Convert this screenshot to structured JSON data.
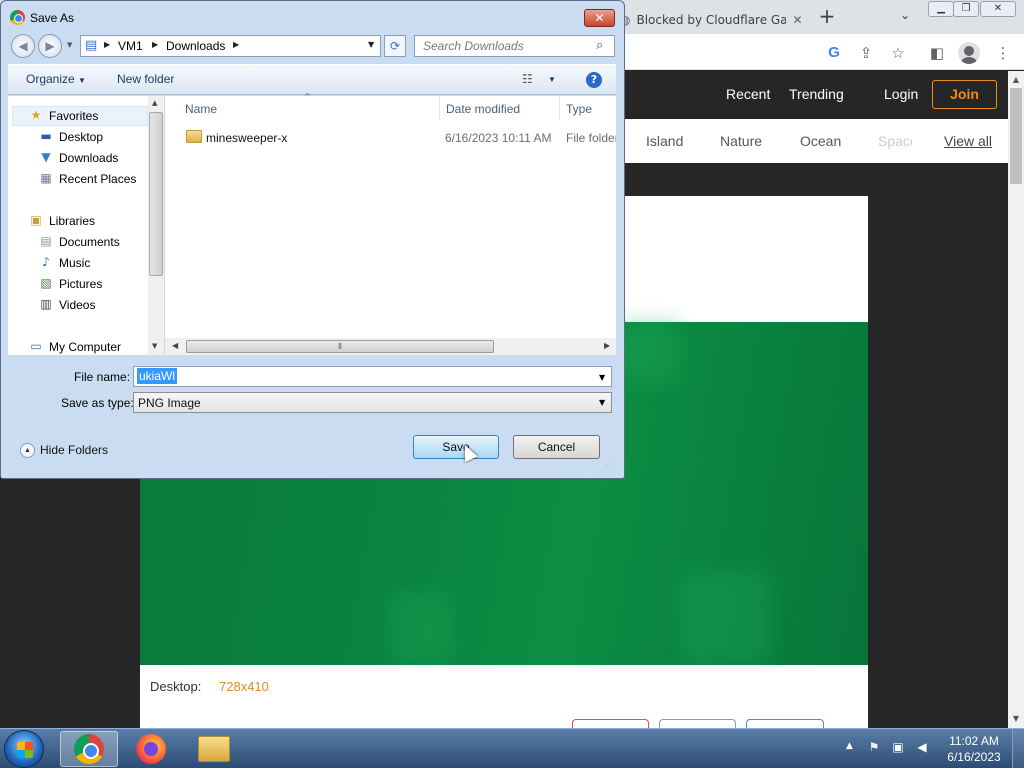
{
  "browser": {
    "tab_title": "Blocked by Cloudflare Ga",
    "tab_close": "✕",
    "new_tab": "+",
    "nav": [
      "Recent",
      "Trending",
      "Login"
    ],
    "join": "Join",
    "categories": [
      "Island",
      "Nature",
      "Ocean",
      "Space",
      "View all"
    ],
    "desktop_label": "Desktop:",
    "desktop_size": "728x410"
  },
  "dialog": {
    "title": "Save As",
    "breadcrumb": [
      "VM1",
      "Downloads"
    ],
    "search_placeholder": "Search Downloads",
    "organize": "Organize",
    "new_folder": "New folder",
    "nav": {
      "favorites": "Favorites",
      "desktop": "Desktop",
      "downloads": "Downloads",
      "recent_places": "Recent Places",
      "libraries": "Libraries",
      "documents": "Documents",
      "music": "Music",
      "pictures": "Pictures",
      "videos": "Videos",
      "my_computer": "My Computer"
    },
    "columns": {
      "name": "Name",
      "date": "Date modified",
      "type": "Type"
    },
    "files": [
      {
        "name": "minesweeper-x",
        "date": "6/16/2023 10:11 AM",
        "type": "File folder"
      }
    ],
    "file_name_label": "File name:",
    "file_name_value": "ukiaWl",
    "save_type_label": "Save as type:",
    "save_type_value": "PNG Image",
    "hide_folders": "Hide Folders",
    "save": "Save",
    "cancel": "Cancel"
  },
  "taskbar": {
    "time": "11:02 AM",
    "date": "6/16/2023"
  }
}
